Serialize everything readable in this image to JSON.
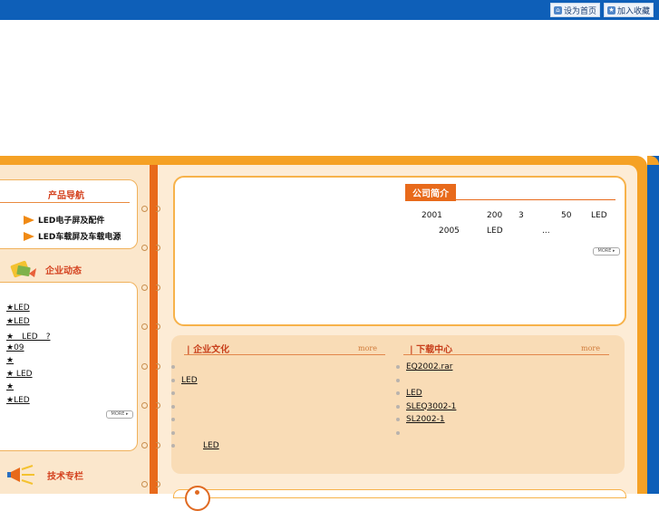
{
  "header": {
    "set_home": "设为首页",
    "add_favorite": "加入收藏"
  },
  "product_nav": {
    "title": "产品导航",
    "items": [
      "LED电子屏及配件",
      "LED车载屏及车载电源"
    ]
  },
  "news": {
    "title": "企业动态",
    "items": [
      "★LED",
      "★LED",
      "★　LED　?",
      "★09",
      "★",
      "★ LED",
      "★",
      "★LED"
    ],
    "more": "MORE ▸"
  },
  "tech": {
    "title": "技术专栏"
  },
  "intro": {
    "title": "公司简介",
    "line1": [
      "2001",
      "200",
      "3",
      "50",
      "LED"
    ],
    "line2": [
      "2005",
      "LED",
      "..."
    ],
    "more": "MORE ▸"
  },
  "culture": {
    "title": "| 企业文化",
    "more": "more",
    "items": [
      "",
      "LED",
      "",
      "",
      "",
      "",
      "LED"
    ]
  },
  "downloads": {
    "title": "| 下载中心",
    "more": "more",
    "items": [
      "EQ2002.rar",
      "",
      "LED",
      "SLEQ3002-1",
      "SL2002-1",
      ""
    ]
  },
  "colors": {
    "orange": "#f5a125",
    "blue": "#0e5fb8",
    "accent": "#e86a1b"
  },
  "icons": [
    "home-icon",
    "favorite-icon",
    "news-icon",
    "tech-megaphone-icon",
    "arrow-icon"
  ]
}
